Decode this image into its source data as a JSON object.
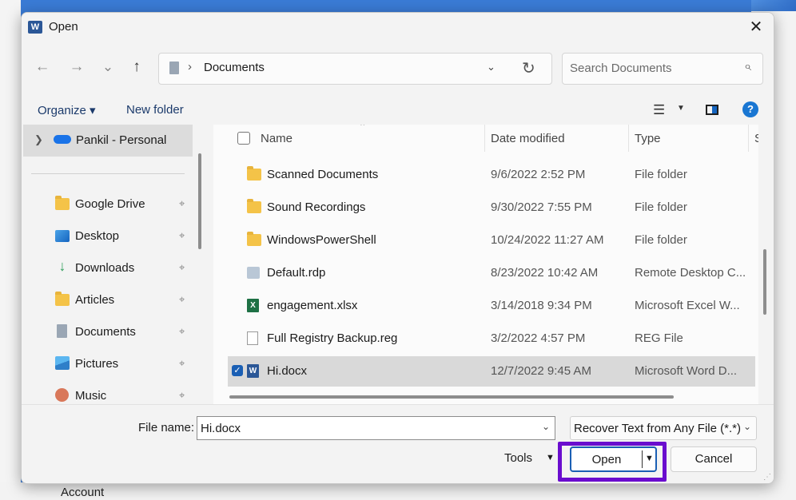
{
  "background": {
    "account_label": "Account"
  },
  "dialog": {
    "title": "Open",
    "app_icon_letter": "W",
    "close_glyph": "✕"
  },
  "navigation": {
    "back": "←",
    "forward": "→",
    "recent": "⌄",
    "up": "↑",
    "address": {
      "separator": "›",
      "location": "Documents"
    },
    "search_placeholder": "Search Documents"
  },
  "commandbar": {
    "organize": "Organize ▾",
    "new_folder": "New folder",
    "help": "?"
  },
  "sidebar": {
    "onedrive": "Pankil - Personal",
    "items": [
      {
        "label": "Google Drive",
        "icon": "folder-icon"
      },
      {
        "label": "Desktop",
        "icon": "desktop-icon"
      },
      {
        "label": "Downloads",
        "icon": "download-icon"
      },
      {
        "label": "Articles",
        "icon": "folder-icon"
      },
      {
        "label": "Documents",
        "icon": "documents-icon"
      },
      {
        "label": "Pictures",
        "icon": "pictures-icon"
      },
      {
        "label": "Music",
        "icon": "music-icon"
      }
    ],
    "pin_glyph": "📌"
  },
  "filelist": {
    "columns": {
      "name": "Name",
      "date": "Date modified",
      "type": "Type",
      "size": "S"
    },
    "rows": [
      {
        "name": "Scanned Documents",
        "date": "9/6/2022 2:52 PM",
        "type": "File folder",
        "icon": "folder-icon"
      },
      {
        "name": "Sound Recordings",
        "date": "9/30/2022 7:55 PM",
        "type": "File folder",
        "icon": "folder-icon"
      },
      {
        "name": "WindowsPowerShell",
        "date": "10/24/2022 11:27 AM",
        "type": "File folder",
        "icon": "folder-icon"
      },
      {
        "name": "Default.rdp",
        "date": "8/23/2022 10:42 AM",
        "type": "Remote Desktop C...",
        "icon": "rdp-icon"
      },
      {
        "name": "engagement.xlsx",
        "date": "3/14/2018 9:34 PM",
        "type": "Microsoft Excel W...",
        "icon": "excel-icon"
      },
      {
        "name": "Full Registry Backup.reg",
        "date": "3/2/2022 4:57 PM",
        "type": "REG File",
        "icon": "registry-icon"
      },
      {
        "name": "Hi.docx",
        "date": "12/7/2022 9:45 AM",
        "type": "Microsoft Word D...",
        "icon": "word-icon",
        "selected": true
      }
    ]
  },
  "footer": {
    "file_name_label": "File name:",
    "file_name_value": "Hi.docx",
    "filter_value": "Recover Text from Any File (*.*)",
    "tools": "Tools",
    "open": "Open",
    "cancel": "Cancel"
  },
  "colors": {
    "accent": "#1a5fb4",
    "highlight": "#6a0dce",
    "folder": "#f4c348"
  }
}
